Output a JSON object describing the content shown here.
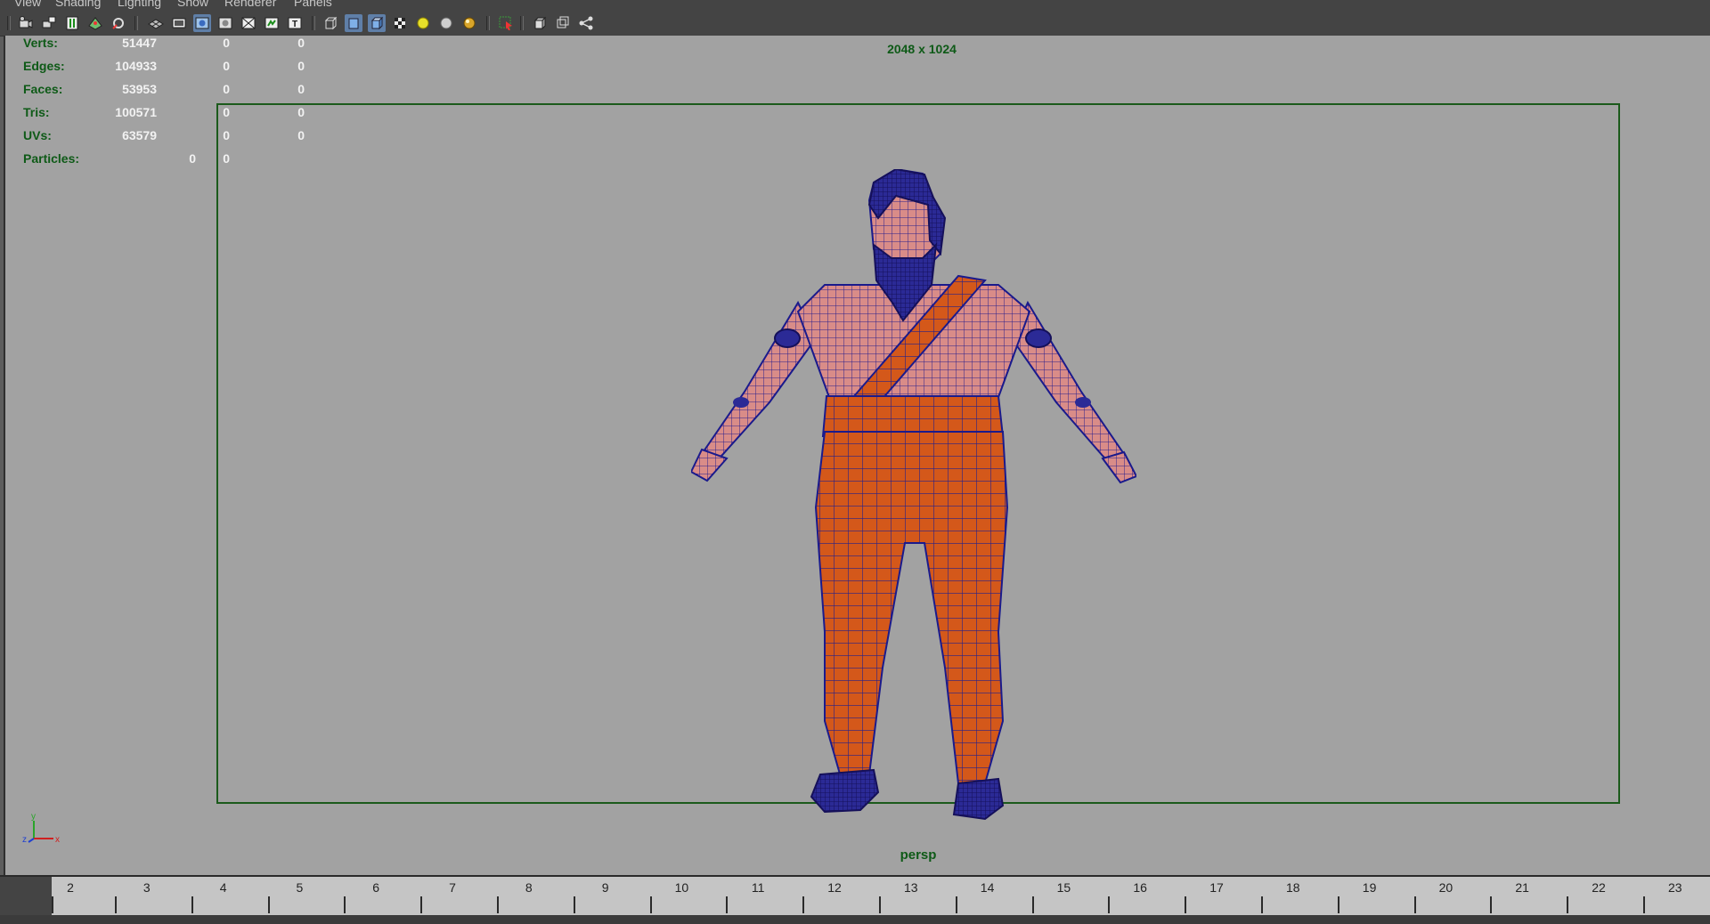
{
  "menu": {
    "items": [
      "View",
      "Shading",
      "Lighting",
      "Show",
      "Renderer",
      "Panels"
    ]
  },
  "toolbar": {
    "icons": [
      "select-camera",
      "camera-attributes",
      "bookmarks",
      "image-plane",
      "two-d-pan-zoom",
      "grid",
      "film-gate",
      "resolution-gate",
      "gate-mask",
      "field-chart",
      "safe-action",
      "safe-title",
      "wireframe",
      "smooth-shade",
      "wireframe-on-shaded",
      "textured",
      "default-lighting",
      "shadows",
      "high-quality",
      "isolate-select",
      "xray",
      "xray-joints",
      "ui-share"
    ]
  },
  "hud": {
    "rows": [
      {
        "label": "Verts:",
        "a": "51447",
        "b": "0",
        "c": "0"
      },
      {
        "label": "Edges:",
        "a": "104933",
        "b": "0",
        "c": "0"
      },
      {
        "label": "Faces:",
        "a": "53953",
        "b": "0",
        "c": "0"
      },
      {
        "label": "Tris:",
        "a": "100571",
        "b": "0",
        "c": "0"
      },
      {
        "label": "UVs:",
        "a": "63579",
        "b": "0",
        "c": "0"
      }
    ],
    "particles": {
      "label": "Particles:",
      "a": "0",
      "b": "0"
    }
  },
  "viewport": {
    "resolution": "2048 x 1024",
    "camera": "persp",
    "axis": {
      "y": "y",
      "z": "z",
      "x": "x"
    }
  },
  "timeline": {
    "labels": [
      "2",
      "3",
      "4",
      "5",
      "6",
      "7",
      "8",
      "9",
      "10",
      "11",
      "12",
      "13",
      "14",
      "15",
      "16",
      "17",
      "18",
      "19",
      "20",
      "21",
      "22",
      "23"
    ]
  },
  "colors": {
    "hud_label": "#0e5a17",
    "hud_value": "#f2f2f2",
    "viewport_bg": "#a2a2a2",
    "gate_border": "#1b5a1b",
    "wire": "#1a1a8c",
    "skin": "#d88a86",
    "cloth": "#d4581a"
  }
}
